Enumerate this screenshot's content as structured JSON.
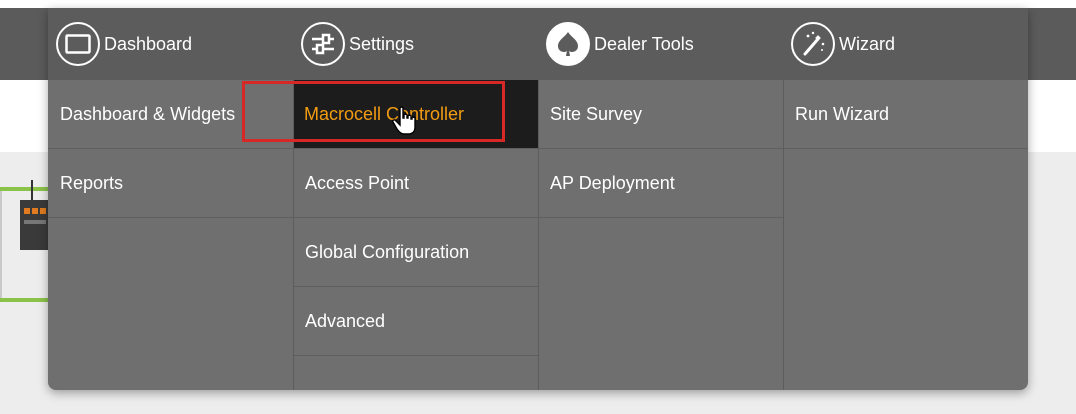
{
  "menu": {
    "columns": [
      {
        "header": "Dashboard",
        "icon": "dashboard-icon",
        "items": [
          "Dashboard & Widgets",
          "Reports"
        ]
      },
      {
        "header": "Settings",
        "icon": "settings-icon",
        "items": [
          "Macrocell Controller",
          "Access Point",
          "Global Configuration",
          "Advanced"
        ]
      },
      {
        "header": "Dealer Tools",
        "icon": "dealer-tools-icon",
        "items": [
          "Site Survey",
          "AP Deployment"
        ]
      },
      {
        "header": "Wizard",
        "icon": "wizard-icon",
        "items": [
          "Run Wizard"
        ]
      }
    ],
    "active_item": "Macrocell Controller",
    "colors": {
      "menu_bg": "#6f6f6f",
      "header_bg": "#5c5c5c",
      "active_bg": "#1c1c1c",
      "active_text": "#f39c12",
      "highlight_border": "#d72828",
      "status_line": "#8bc34a"
    }
  }
}
